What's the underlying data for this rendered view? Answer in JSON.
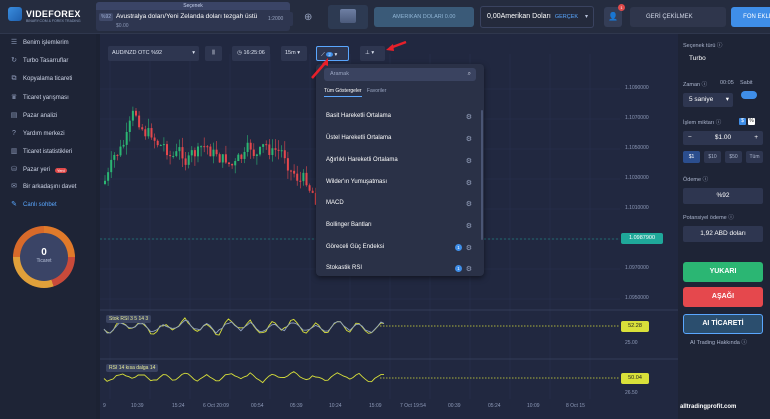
{
  "topbar": {
    "logo_text": "VIDEFOREX",
    "logo_sub": "BINARY.COM & FOREX TRADING",
    "asset_tab_header": "Seçenek",
    "asset_pct": "%92",
    "asset_name": "Avustralya doları/Yeni Zelanda doları tezgah üstü",
    "asset_price": "$0.00",
    "tab2_text": "1:2000",
    "account_label": "AMERIKAN DOLARI 0.00",
    "balance": "0,00Amerikan Doları",
    "balance_mode": "GERÇEK",
    "notif_count": "1",
    "withdraw_label": "GERİ ÇEKİLMEK",
    "deposit_label": "FON EKLE"
  },
  "sidebar": {
    "items": [
      {
        "label": "Benim işlemlerim",
        "icon": "list-icon"
      },
      {
        "label": "Turbo Tasarruflar",
        "icon": "bolt-icon"
      },
      {
        "label": "Kopyalama ticareti",
        "icon": "copy-icon"
      },
      {
        "label": "Ticaret yarışması",
        "icon": "trophy-icon"
      },
      {
        "label": "Pazar analizi",
        "icon": "chart-icon"
      },
      {
        "label": "Yardım merkezi",
        "icon": "help-icon"
      },
      {
        "label": "Ticaret istatistikleri",
        "icon": "stats-icon"
      },
      {
        "label": "Pazar yeri",
        "icon": "cart-icon",
        "badge": "Yeni"
      },
      {
        "label": "Bir arkadaşını davet",
        "icon": "invite-icon"
      },
      {
        "label": "Canlı sohbet",
        "icon": "chat-icon"
      }
    ],
    "donut_value": "0",
    "donut_label": "Ticaret"
  },
  "chart": {
    "asset_select": "AUD/NZD OTC %92",
    "time": "16:25:06",
    "timeframe": "15m",
    "indicators_count": "2",
    "price_levels": [
      "1.1090000",
      "1.1070000",
      "1.1050000",
      "1.1030000",
      "1.1010000",
      "1.0970000",
      "1.0950000"
    ],
    "current_price": "1.0987900",
    "stoch_label": "Stok RSI  3 5 14 3",
    "stoch_value": "52.28",
    "stoch_level": "25.00",
    "rsi_label": "RSI  14 kısa dalga 14",
    "rsi_value": "50.04",
    "rsi_level": "26.50",
    "time_labels": [
      "9",
      "10:39",
      "15:24",
      "6 Oct 20:09",
      "00:54",
      "05:39",
      "10:24",
      "15:09",
      "7 Oct 19:54",
      "00:39",
      "05:24",
      "10:09",
      "8 Oct 15"
    ]
  },
  "chart_data": {
    "type": "line",
    "title": "",
    "xlabel": "",
    "ylabel": "",
    "ylim": [
      1.094,
      1.11
    ],
    "current": 1.09879
  },
  "dropdown": {
    "search_placeholder": "Aramak",
    "tab_all": "Tüm Göstergeler",
    "tab_fav": "Favoriler",
    "items": [
      {
        "label": "Basit Hareketli Ortalama",
        "info": false
      },
      {
        "label": "Üstel Hareketli Ortalama",
        "info": false
      },
      {
        "label": "Ağırlıklı Hareketli Ortalama",
        "info": false
      },
      {
        "label": "Wilder'ın Yumuşatması",
        "info": false
      },
      {
        "label": "MACD",
        "info": false
      },
      {
        "label": "Bollinger Bantları",
        "info": false
      },
      {
        "label": "Göreceli Güç Endeksi",
        "info": true
      },
      {
        "label": "Stokastik RSI",
        "info": true
      }
    ]
  },
  "rightpanel": {
    "option_type_label": "Seçenek türü ⓘ",
    "option_type": "Turbo",
    "time_label": "Zaman ⓘ",
    "time_clock": "00:05",
    "fixed_label": "Sabit",
    "duration": "5 saniye",
    "amount_label": "İşlem miktarı ⓘ",
    "amount": "$1.00",
    "quick_amounts": [
      "$1",
      "$10",
      "$50",
      "Tüm"
    ],
    "payout_label": "Ödeme ⓘ",
    "payout": "%92",
    "potential_label": "Potansiyel ödeme ⓘ",
    "potential": "1,92 ABD doları",
    "up_label": "YUKARI",
    "down_label": "AŞAĞI",
    "ai_label": "AI TİCARETİ",
    "ai_about": "AI Trading Hakkında ⓘ"
  },
  "watermark": "alltradingprofit.com",
  "colors": {
    "up": "#2bb673",
    "down": "#e5484d",
    "accent": "#3f8ee8",
    "price": "#1fa89a",
    "indicator": "#d8e03a",
    "arrow": "#e8202a"
  }
}
